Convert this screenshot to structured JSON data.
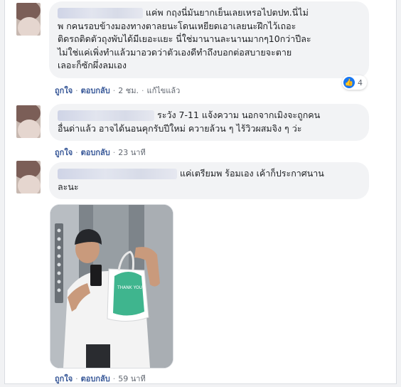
{
  "comments": [
    {
      "text": "แค่พ กฤงนี่มันยากเย็นเลยเหรอไปตปท.นี่ไม่\nพ กคนรอบข้างมองทางตาลยนะโดนเหยียดเอาเลยนะฝึกไว้เถอะ\nติดรถติดตัวถุงพับได้มีเยอะแยะ นี่ใช่มานานละนานมากๆ10กว่าปีละ\nไม่ใช่แค่เพิ่งทำแล้วมาอวดว่าตัวเองดีทำถึงบอกต่อสบายจะตาย\nเลอะก็ซักผึ่งลมเอง",
      "like": "ถูกใจ",
      "reply": "ตอบกลับ",
      "time": "2 ชม.",
      "edited": "แก้ไขแล้ว",
      "reaction_count": "4"
    },
    {
      "text": "ระวัง 7-11 แจ้งความ นอกจากเมิงจะถูกคน\nอื่นด่าแล้ว อาจได้นอนคุกรับปีใหม่ ควายล้วน ๆ ไร้วิวผสมจิง ๆ ว่ะ",
      "like": "ถูกใจ",
      "reply": "ตอบกลับ",
      "time": "23 นาที"
    },
    {
      "text": "แค่เตรียมพ ร้อมเอง เค้าก็ประกาศนาน\nละนะ",
      "like": "ถูกใจ",
      "reply": "ตอบกลับ",
      "time": "59 นาที",
      "photo": {
        "bag_text": "THANK YOU",
        "bag_color": "#3fb58e"
      }
    }
  ],
  "colors": {
    "link": "#385898",
    "bubble": "#f2f3f5",
    "reaction": "#1877f2"
  }
}
